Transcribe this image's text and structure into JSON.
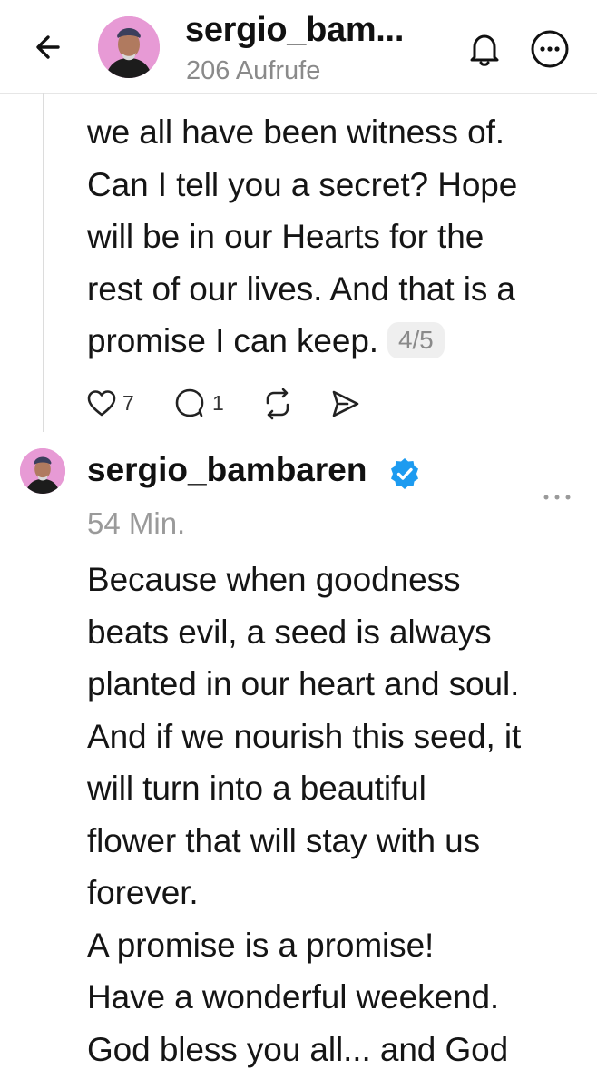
{
  "header": {
    "title": "sergio_bam...",
    "views": "206 Aufrufe"
  },
  "post1": {
    "text": "we all have been witness of.\nCan I tell you a secret? Hope\nwill be in our Hearts for the\nrest of our lives. And that is a\npromise I can keep.",
    "pager": "4/5",
    "likes": "7",
    "replies": "1"
  },
  "post2": {
    "username": "sergio_bambaren",
    "time": "54 Min.",
    "text": "Because when goodness\nbeats evil, a seed is always\nplanted in our heart and soul.\nAnd if we nourish this seed, it\nwill turn into a beautiful\nflower that will stay with us\nforever.\nA promise is a promise!\nHave a wonderful weekend.\nGod bless you all... and God"
  },
  "icons": {
    "back": "arrow-left-icon",
    "notifications": "bell-icon",
    "more": "more-circle-icon",
    "like": "heart-icon",
    "reply": "comment-icon",
    "repost": "repost-icon",
    "share": "send-icon",
    "verified": "verified-badge-icon",
    "post_menu": "ellipsis-icon"
  },
  "colors": {
    "verified": "#1d9bf0",
    "avatar_bg": "#e79ad5",
    "muted_text": "#8a8a8a"
  }
}
